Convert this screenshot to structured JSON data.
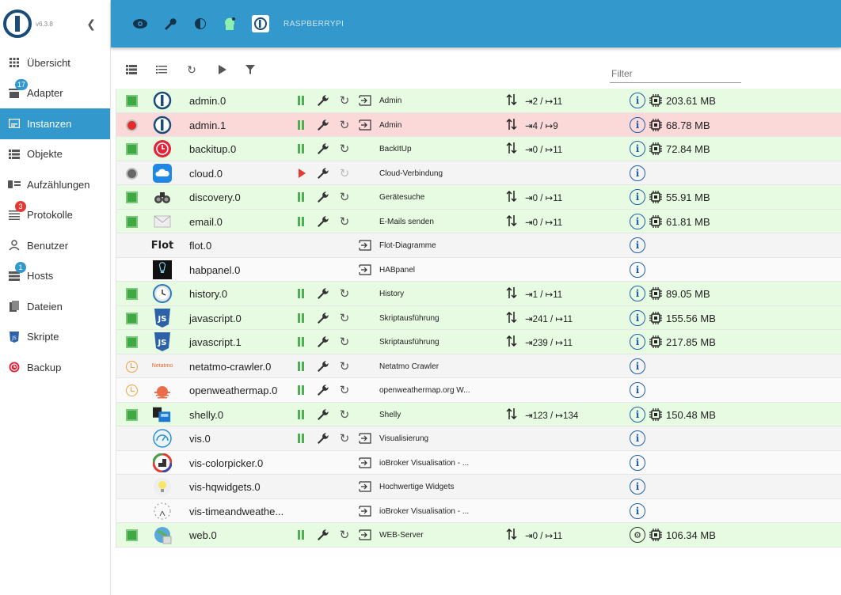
{
  "app": {
    "version": "v6.3.8",
    "host": "RASPBERRYPI"
  },
  "sidebar": {
    "items": [
      {
        "label": "Übersicht",
        "icon": "grid-icon"
      },
      {
        "label": "Adapter",
        "icon": "store-icon",
        "badge": "17"
      },
      {
        "label": "Instanzen",
        "icon": "instances-icon",
        "active": true
      },
      {
        "label": "Objekte",
        "icon": "list-icon"
      },
      {
        "label": "Aufzählungen",
        "icon": "enum-icon"
      },
      {
        "label": "Protokolle",
        "icon": "log-icon",
        "badge": "3"
      },
      {
        "label": "Benutzer",
        "icon": "user-icon"
      },
      {
        "label": "Hosts",
        "icon": "hosts-icon",
        "badge": "1"
      },
      {
        "label": "Dateien",
        "icon": "files-icon"
      },
      {
        "label": "Skripte",
        "icon": "javascript-icon"
      },
      {
        "label": "Backup",
        "icon": "backup-icon"
      }
    ]
  },
  "toolbar": {
    "filter_placeholder": "Filter"
  },
  "instances": [
    {
      "name": "admin.0",
      "title": "Admin",
      "status": "running",
      "io": "⇥2 / ↦11",
      "mem": "203.61 MB",
      "bg": "green",
      "icon": "iobroker-icon",
      "pause": true,
      "open": true,
      "arrows": true
    },
    {
      "name": "admin.1",
      "title": "Admin",
      "status": "error",
      "io": "⇥4 / ↦9",
      "mem": "68.78 MB",
      "bg": "red",
      "icon": "iobroker-icon",
      "pause": true,
      "open": true,
      "arrows": true
    },
    {
      "name": "backitup.0",
      "title": "BackItUp",
      "status": "running",
      "io": "⇥0 / ↦11",
      "mem": "72.84 MB",
      "bg": "green",
      "icon": "backitup-icon",
      "pause": true,
      "open": false,
      "arrows": true
    },
    {
      "name": "cloud.0",
      "title": "Cloud-Verbindung",
      "status": "stopped",
      "io": "",
      "mem": "",
      "bg": "grey",
      "icon": "cloud-icon",
      "play": true,
      "open": false,
      "dimReload": true
    },
    {
      "name": "discovery.0",
      "title": "Gerätesuche",
      "status": "running",
      "io": "⇥0 / ↦11",
      "mem": "55.91 MB",
      "bg": "green",
      "icon": "binoculars-icon",
      "pause": true,
      "open": false,
      "arrows": true
    },
    {
      "name": "email.0",
      "title": "E-Mails senden",
      "status": "running",
      "io": "⇥0 / ↦11",
      "mem": "61.81 MB",
      "bg": "green",
      "icon": "email-icon",
      "pause": true,
      "open": false,
      "arrows": true
    },
    {
      "name": "flot.0",
      "title": "Flot-Diagramme",
      "status": "none",
      "io": "",
      "mem": "",
      "bg": "grey",
      "icon": "flot-icon",
      "flotLabel": "Flot",
      "noActions": true,
      "open": true
    },
    {
      "name": "habpanel.0",
      "title": "HABpanel",
      "status": "none",
      "io": "",
      "mem": "",
      "bg": "white",
      "icon": "habpanel-icon",
      "noActions": true,
      "open": true
    },
    {
      "name": "history.0",
      "title": "History",
      "status": "running",
      "io": "⇥1 / ↦11",
      "mem": "89.05 MB",
      "bg": "green",
      "icon": "history-icon",
      "pause": true,
      "open": false,
      "arrows": true
    },
    {
      "name": "javascript.0",
      "title": "Skriptausführung",
      "status": "running",
      "io": "⇥241 / ↦11",
      "mem": "155.56 MB",
      "bg": "green",
      "icon": "javascript-icon",
      "pause": true,
      "open": false,
      "arrows": true
    },
    {
      "name": "javascript.1",
      "title": "Skriptausführung",
      "status": "running",
      "io": "⇥239 / ↦11",
      "mem": "217.85 MB",
      "bg": "green",
      "icon": "javascript-icon",
      "pause": true,
      "open": false,
      "arrows": true
    },
    {
      "name": "netatmo-crawler.0",
      "title": "Netatmo Crawler",
      "status": "scheduled",
      "io": "",
      "mem": "",
      "bg": "grey",
      "icon": "netatmo-icon",
      "netatmoLabel": "Netatmo",
      "pause": true,
      "open": false
    },
    {
      "name": "openweathermap.0",
      "title": "openweathermap.org W...",
      "status": "scheduled",
      "io": "",
      "mem": "",
      "bg": "white",
      "icon": "weather-icon",
      "pause": true,
      "open": false
    },
    {
      "name": "shelly.0",
      "title": "Shelly",
      "status": "running",
      "io": "⇥123 / ↦134",
      "mem": "150.48 MB",
      "bg": "green",
      "icon": "shelly-icon",
      "pause": true,
      "open": false,
      "arrows": true
    },
    {
      "name": "vis.0",
      "title": "Visualisierung",
      "status": "none",
      "io": "",
      "mem": "",
      "bg": "grey",
      "icon": "vis-icon",
      "pause": true,
      "open": true
    },
    {
      "name": "vis-colorpicker.0",
      "title": "ioBroker Visualisation - ...",
      "status": "none",
      "io": "",
      "mem": "",
      "bg": "white",
      "icon": "colorpicker-icon",
      "noActions": true,
      "open": true
    },
    {
      "name": "vis-hqwidgets.0",
      "title": "Hochwertige Widgets",
      "status": "none",
      "io": "",
      "mem": "",
      "bg": "grey",
      "icon": "bulb-icon",
      "noActions": true,
      "open": true
    },
    {
      "name": "vis-timeandweathe...",
      "title": "ioBroker Visualisation - ...",
      "status": "none",
      "io": "",
      "mem": "",
      "bg": "white",
      "icon": "clock-widget-icon",
      "noActions": true,
      "open": true
    },
    {
      "name": "web.0",
      "title": "WEB-Server",
      "status": "running",
      "io": "⇥0 / ↦11",
      "mem": "106.34 MB",
      "bg": "green",
      "icon": "globe-icon",
      "pause": true,
      "open": true,
      "arrows": true,
      "gearInfo": true
    }
  ]
}
